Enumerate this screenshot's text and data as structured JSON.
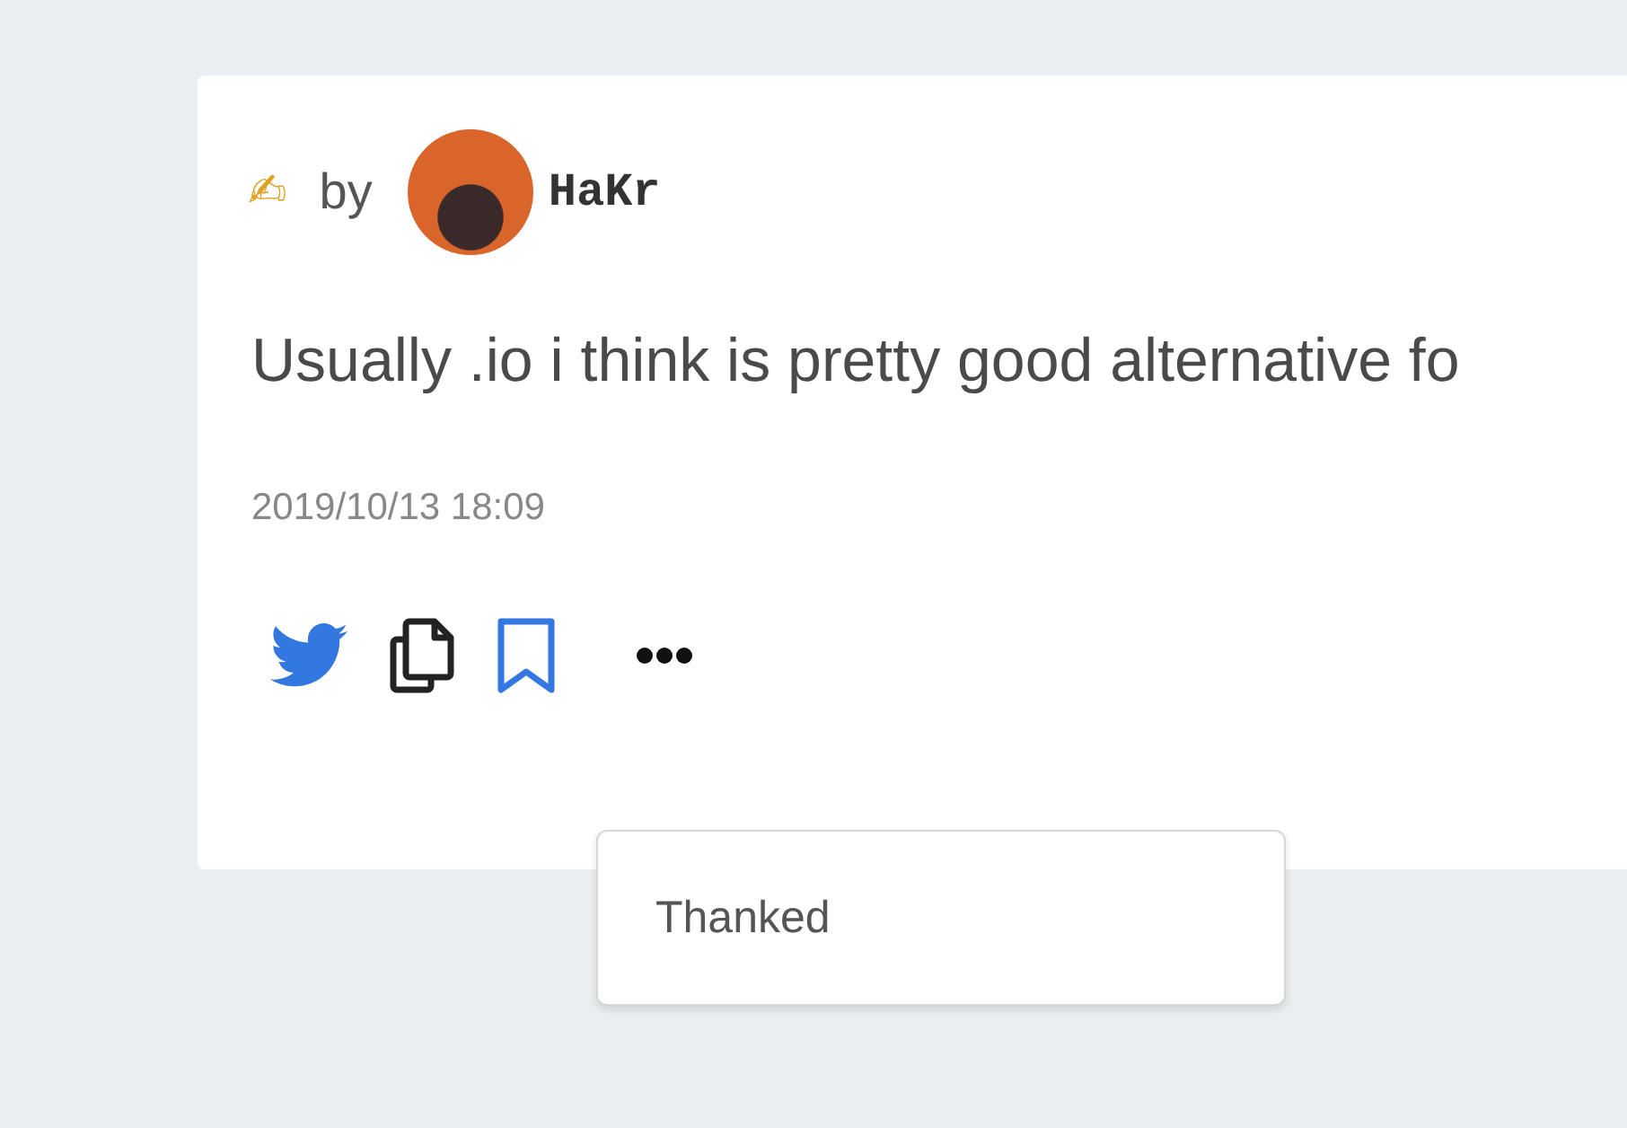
{
  "post": {
    "pen": "✍",
    "by": "by",
    "author": "HaKr",
    "body": "Usually .io i think is pretty good alternative fo",
    "date": "2019/10/13 18:09"
  },
  "menu": {
    "items": [
      {
        "label": "Thanked"
      }
    ]
  }
}
